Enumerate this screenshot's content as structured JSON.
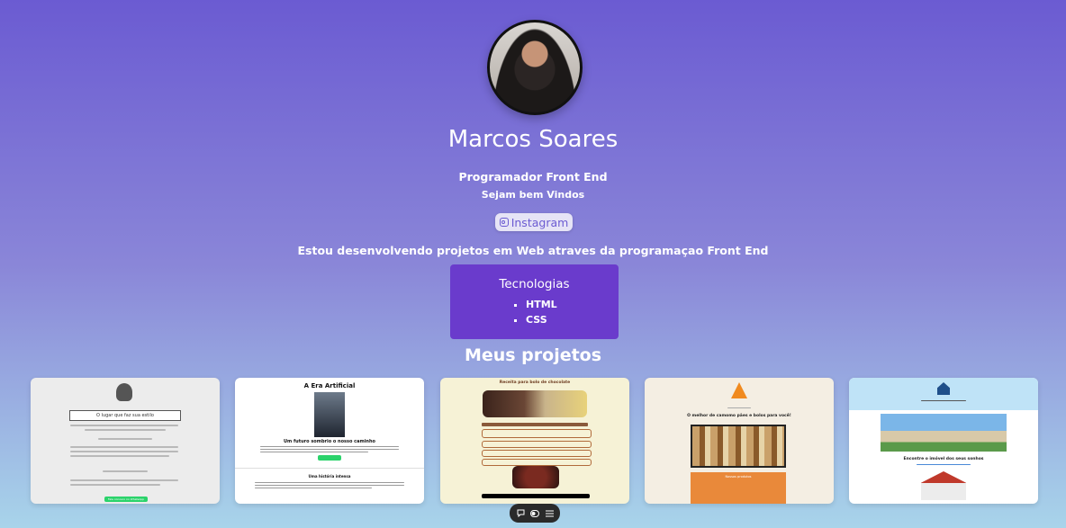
{
  "profile": {
    "name": "Marcos Soares",
    "role": "Programador Front End",
    "welcome": "Sejam bem Vindos",
    "instagram_label": "Instagram",
    "description": "Estou desenvolvendo projetos em Web atraves da programaçao Front End"
  },
  "tech": {
    "title": "Tecnologias",
    "items": [
      "HTML",
      "CSS"
    ]
  },
  "projects": {
    "title": "Meus projetos",
    "cards": [
      {
        "heading": "O lugar que faz sua estilo",
        "button": "Fale conosco no WhatsApp"
      },
      {
        "heading": "A Era Artificial",
        "subheading": "Um futuro sombrio o nosso caminho",
        "section": "Uma história intensa"
      },
      {
        "heading": "Receita para bolo de chocolate"
      },
      {
        "heading": "O melhor de camomo pães e bolos para você!",
        "section": "Nossos produtos"
      },
      {
        "heading": "Encontre o imóvel dos seus sonhos"
      }
    ]
  },
  "toolbar": {
    "icons": [
      "comment-icon",
      "toggle-icon",
      "menu-icon"
    ]
  },
  "colors": {
    "accent": "#6a3bcc",
    "link": "#6b5bd2"
  }
}
